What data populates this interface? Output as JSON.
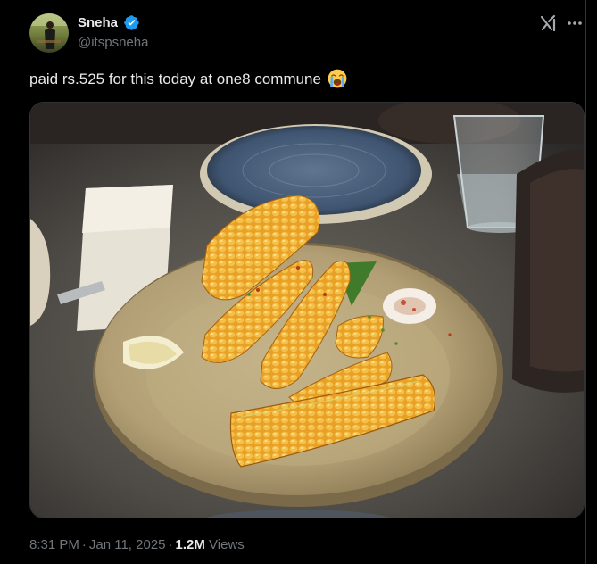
{
  "author": {
    "display_name": "Sneha",
    "handle": "@itspsneha",
    "verified": true
  },
  "header_actions": {
    "grok_icon": "grok-icon",
    "more_icon": "more-icon"
  },
  "tweet": {
    "text": "paid rs.525 for this today at one8 commune",
    "emoji": "loudly-crying-face",
    "media_alt": "photo of grilled corn on the cob pieces on a plate"
  },
  "meta": {
    "time": "8:31 PM",
    "separator": "·",
    "date": "Jan 11, 2025",
    "views_count": "1.2M",
    "views_label": "Views"
  },
  "colors": {
    "background": "#000000",
    "text_primary": "#e7e9ea",
    "text_secondary": "#71767b",
    "verified_blue": "#1d9bf0",
    "border": "#2f3336"
  }
}
